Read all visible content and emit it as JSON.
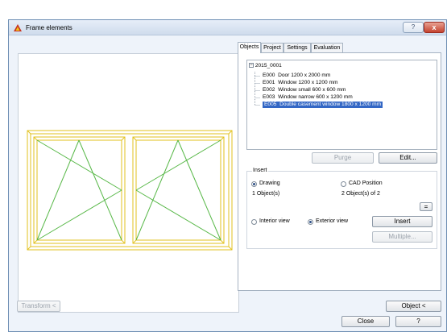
{
  "window": {
    "title": "Frame elements",
    "help_label": "?",
    "close_label": "x"
  },
  "tabs": [
    {
      "label": "Objects",
      "active": true
    },
    {
      "label": "Project",
      "active": false
    },
    {
      "label": "Settings",
      "active": false
    },
    {
      "label": "Evaluation",
      "active": false
    }
  ],
  "tree": {
    "root": "2015_0001",
    "root_toggle": "−",
    "items": [
      {
        "code": "E000",
        "desc": "Door 1200 x 2000 mm",
        "selected": false
      },
      {
        "code": "E001",
        "desc": "Window  1200 x 1200 mm",
        "selected": false
      },
      {
        "code": "E002",
        "desc": "Window small 600 x 600 mm",
        "selected": false
      },
      {
        "code": "E003",
        "desc": "Window narrow 600 x 1200 mm",
        "selected": false
      },
      {
        "code": "E005",
        "desc": "Double casement window 1800 x 1200 mm",
        "selected": true
      }
    ]
  },
  "buttons": {
    "purge": "Purge",
    "edit": "Edit...",
    "equals": "=",
    "insert": "Insert",
    "multiple": "Multiple...",
    "transform": "Transform <",
    "object": "Object <",
    "close": "Close",
    "help": "?"
  },
  "insert": {
    "group_label": "Insert",
    "drawing_label": "Drawing",
    "drawing_checked": true,
    "drawing_count": "1 Object(s)",
    "cad_label": "CAD Position",
    "cad_checked": false,
    "cad_count": "2 Object(s) of 2",
    "interior_label": "Interior view",
    "interior_checked": false,
    "exterior_label": "Exterior view",
    "exterior_checked": true
  },
  "colors": {
    "frame_line": "#e2c21e",
    "sash_line": "#58b848",
    "selection": "#3367c5",
    "close_button": "#c4432f"
  },
  "icons": {
    "app": "window-frame-icon"
  }
}
